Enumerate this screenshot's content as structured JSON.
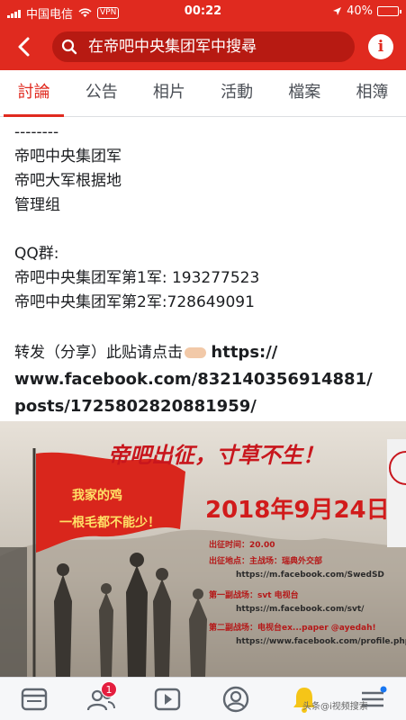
{
  "status_bar": {
    "carrier": "中国电信",
    "vpn": "VPN",
    "time": "00:22",
    "battery": "40%",
    "battery_level": 0.4
  },
  "search": {
    "placeholder": "在帝吧中央集团军中搜尋"
  },
  "tabs": [
    {
      "label": "討論",
      "active": true
    },
    {
      "label": "公告"
    },
    {
      "label": "相片"
    },
    {
      "label": "活動"
    },
    {
      "label": "檔案"
    },
    {
      "label": "相簿"
    }
  ],
  "post": {
    "lines": [
      "--------",
      "帝吧中央集团军",
      "帝吧大军根据地",
      "管理组",
      "",
      "QQ群:",
      "帝吧中央集团军第1军: 193277523",
      "帝吧中央集团军第2军:728649091",
      ""
    ],
    "share_text": "转发（分享）此贴请点击",
    "link_lines": [
      "https://",
      "www.facebook.com/832140356914881/",
      "posts/1725802820881959/"
    ]
  },
  "poster": {
    "title": "帝吧出征，寸草不生！",
    "flag_line1": "我家的鸡",
    "flag_line2": "一根毛都不能少！",
    "date": "2018年9月24日",
    "details": [
      "出征时间：20.00",
      "出征地点：主战场：瑞典外交部",
      "https://m.facebook.com/SwedSD",
      "第一副战场：svt 电视台",
      "https://m.facebook.com/svt/",
      "第二副战场：电视台ex...paper @ayedah!",
      "https://www.facebook.com/profile.php?id="
    ]
  },
  "tab_bar": {
    "items": [
      {
        "name": "news-feed"
      },
      {
        "name": "friends",
        "badge": "1"
      },
      {
        "name": "watch"
      },
      {
        "name": "profile"
      },
      {
        "name": "notifications"
      },
      {
        "name": "menu"
      }
    ],
    "watermark": "头条@i视频搜索"
  },
  "colors": {
    "brand_red": "#e02a1f",
    "search_bg": "#b71a12",
    "badge_red": "#e41e3f"
  }
}
